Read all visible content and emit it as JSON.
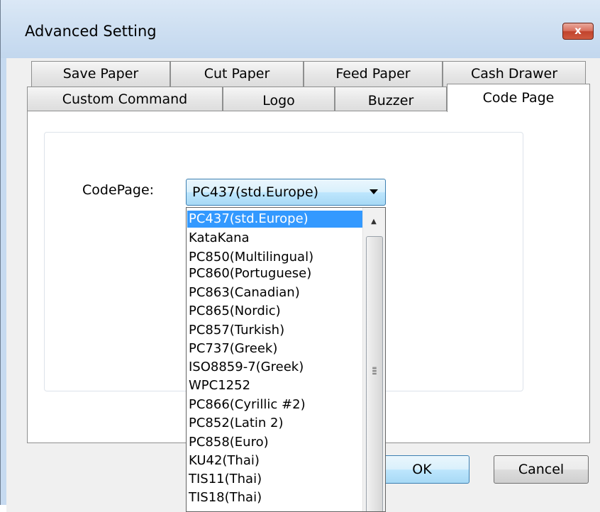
{
  "window": {
    "title": "Advanced Setting",
    "close_label": "x"
  },
  "tabs_row1": [
    "Save Paper",
    "Cut Paper",
    "Feed Paper",
    "Cash Drawer"
  ],
  "tabs_row2": [
    "Custom Command",
    "Logo",
    "Buzzer",
    "Code Page"
  ],
  "active_tab": "Code Page",
  "codepage": {
    "label": "CodePage:",
    "selected": "PC437(std.Europe)",
    "options": [
      "PC437(std.Europe)",
      "KataKana",
      "PC850(Multilingual)",
      "PC860(Portuguese)",
      "PC863(Canadian)",
      "PC865(Nordic)",
      "PC857(Turkish)",
      "PC737(Greek)",
      "ISO8859-7(Greek)",
      "WPC1252",
      "PC866(Cyrillic #2)",
      "PC852(Latin 2)",
      "PC858(Euro)",
      "KU42(Thai)",
      "TIS11(Thai)",
      "TIS18(Thai)"
    ]
  },
  "buttons": {
    "ok": "OK",
    "cancel": "Cancel"
  },
  "colors": {
    "selection": "#3399ff",
    "close_button": "#c1432c"
  },
  "icons": {
    "close": "close-icon",
    "dropdown": "chevron-down-icon",
    "scroll_up": "scroll-up-arrow-icon"
  }
}
